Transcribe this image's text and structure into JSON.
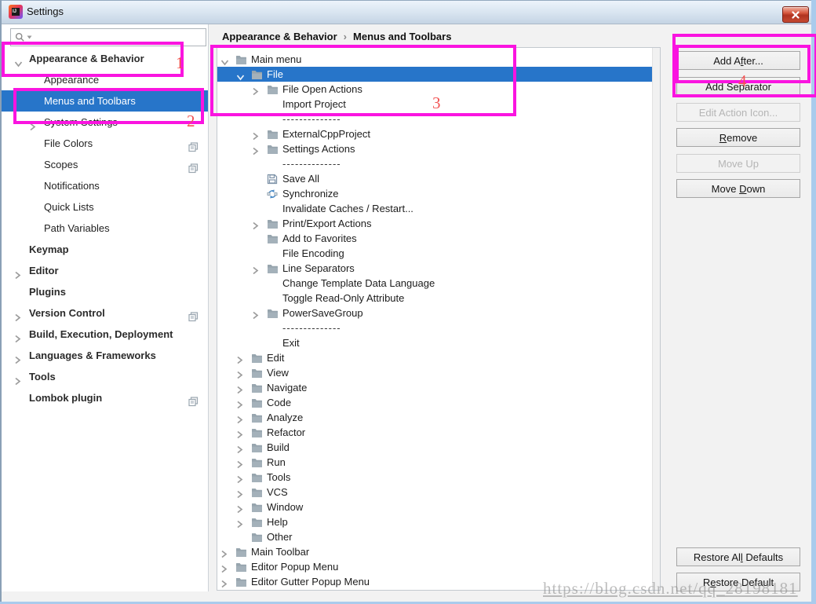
{
  "window": {
    "title": "Settings"
  },
  "search": {
    "value": "",
    "placeholder": ""
  },
  "breadcrumb": {
    "part1": "Appearance & Behavior",
    "separator": "›",
    "part2": "Menus and Toolbars"
  },
  "sidebar": {
    "items": [
      {
        "label": "Appearance & Behavior",
        "level": 0,
        "chevron": "down",
        "bold": true
      },
      {
        "label": "Appearance",
        "level": 1
      },
      {
        "label": "Menus and Toolbars",
        "level": 1,
        "selected": true
      },
      {
        "label": "System Settings",
        "level": 1,
        "chevron": "right"
      },
      {
        "label": "File Colors",
        "level": 1,
        "shared_icon": true
      },
      {
        "label": "Scopes",
        "level": 1,
        "shared_icon": true
      },
      {
        "label": "Notifications",
        "level": 1
      },
      {
        "label": "Quick Lists",
        "level": 1
      },
      {
        "label": "Path Variables",
        "level": 1
      },
      {
        "label": "Keymap",
        "level": 0,
        "bold": true
      },
      {
        "label": "Editor",
        "level": 0,
        "chevron": "right",
        "bold": true
      },
      {
        "label": "Plugins",
        "level": 0,
        "bold": true
      },
      {
        "label": "Version Control",
        "level": 0,
        "chevron": "right",
        "bold": true,
        "shared_icon": true
      },
      {
        "label": "Build, Execution, Deployment",
        "level": 0,
        "chevron": "right",
        "bold": true
      },
      {
        "label": "Languages & Frameworks",
        "level": 0,
        "chevron": "right",
        "bold": true
      },
      {
        "label": "Tools",
        "level": 0,
        "chevron": "right",
        "bold": true
      },
      {
        "label": "Lombok plugin",
        "level": 0,
        "bold": true,
        "shared_icon": true
      }
    ]
  },
  "tree": {
    "separator_label": "--------------",
    "rows": [
      {
        "label": "Main menu",
        "level": 0,
        "chevron": "down",
        "icon": "folder"
      },
      {
        "label": "File",
        "level": 1,
        "chevron": "down",
        "icon": "folder",
        "selected": true
      },
      {
        "label": "File Open Actions",
        "level": 2,
        "chevron": "right",
        "icon": "folder"
      },
      {
        "label": "Import Project",
        "level": 2
      },
      {
        "separator": true,
        "level": 2
      },
      {
        "label": "ExternalCppProject",
        "level": 2,
        "chevron": "right",
        "icon": "folder"
      },
      {
        "label": "Settings Actions",
        "level": 2,
        "chevron": "right",
        "icon": "folder"
      },
      {
        "separator": true,
        "level": 2
      },
      {
        "label": "Save All",
        "level": 2,
        "icon": "save"
      },
      {
        "label": "Synchronize",
        "level": 2,
        "icon": "sync"
      },
      {
        "label": "Invalidate Caches / Restart...",
        "level": 2
      },
      {
        "label": "Print/Export Actions",
        "level": 2,
        "chevron": "right",
        "icon": "folder"
      },
      {
        "label": "Add to Favorites",
        "level": 2,
        "icon": "folder"
      },
      {
        "label": "File Encoding",
        "level": 2
      },
      {
        "label": "Line Separators",
        "level": 2,
        "chevron": "right",
        "icon": "folder"
      },
      {
        "label": "Change Template Data Language",
        "level": 2
      },
      {
        "label": "Toggle Read-Only Attribute",
        "level": 2
      },
      {
        "label": "PowerSaveGroup",
        "level": 2,
        "chevron": "right",
        "icon": "folder"
      },
      {
        "separator": true,
        "level": 2
      },
      {
        "label": "Exit",
        "level": 2
      },
      {
        "label": "Edit",
        "level": 1,
        "chevron": "right",
        "icon": "folder"
      },
      {
        "label": "View",
        "level": 1,
        "chevron": "right",
        "icon": "folder"
      },
      {
        "label": "Navigate",
        "level": 1,
        "chevron": "right",
        "icon": "folder"
      },
      {
        "label": "Code",
        "level": 1,
        "chevron": "right",
        "icon": "folder"
      },
      {
        "label": "Analyze",
        "level": 1,
        "chevron": "right",
        "icon": "folder"
      },
      {
        "label": "Refactor",
        "level": 1,
        "chevron": "right",
        "icon": "folder"
      },
      {
        "label": "Build",
        "level": 1,
        "chevron": "right",
        "icon": "folder"
      },
      {
        "label": "Run",
        "level": 1,
        "chevron": "right",
        "icon": "folder"
      },
      {
        "label": "Tools",
        "level": 1,
        "chevron": "right",
        "icon": "folder"
      },
      {
        "label": "VCS",
        "level": 1,
        "chevron": "right",
        "icon": "folder"
      },
      {
        "label": "Window",
        "level": 1,
        "chevron": "right",
        "icon": "folder"
      },
      {
        "label": "Help",
        "level": 1,
        "chevron": "right",
        "icon": "folder"
      },
      {
        "label": "Other",
        "level": 1,
        "icon": "folder"
      },
      {
        "label": "Main Toolbar",
        "level": 0,
        "chevron": "right",
        "icon": "folder"
      },
      {
        "label": "Editor Popup Menu",
        "level": 0,
        "chevron": "right",
        "icon": "folder"
      },
      {
        "label": "Editor Gutter Popup Menu",
        "level": 0,
        "chevron": "right",
        "icon": "folder"
      }
    ]
  },
  "action_buttons": [
    {
      "id": "add-after",
      "pre": "Add A",
      "key": "f",
      "post": "ter...",
      "enabled": true
    },
    {
      "id": "add-separator",
      "pre": "Add Separator",
      "key": "",
      "post": "",
      "enabled": true
    },
    {
      "id": "edit-action-icon",
      "pre": "Edit Action Icon...",
      "key": "",
      "post": "",
      "enabled": false
    },
    {
      "id": "remove",
      "pre": "",
      "key": "R",
      "post": "emove",
      "enabled": true
    },
    {
      "id": "move-up",
      "pre": "Move Up",
      "key": "",
      "post": "",
      "enabled": false
    },
    {
      "id": "move-down",
      "pre": "Move ",
      "key": "D",
      "post": "own",
      "enabled": true
    }
  ],
  "restore_buttons": [
    {
      "id": "restore-all-defaults",
      "pre": "Restore Al",
      "key": "l",
      "post": " Defaults",
      "enabled": true
    },
    {
      "id": "restore-default",
      "pre": "R",
      "key": "e",
      "post": "store Default",
      "enabled": true
    }
  ],
  "annotations": {
    "box_color": "#FA14E0",
    "label_color": "#F25353",
    "labels": [
      {
        "text": "1"
      },
      {
        "text": "2"
      },
      {
        "text": "3"
      },
      {
        "text": "4"
      }
    ]
  },
  "watermark": {
    "text": "https://blog.csdn.net/qq_28198181"
  },
  "colors": {
    "selection": "#2775C9",
    "folder": "#97A5AE",
    "sync_arrow": "#4889C6",
    "title_bg": "#d8e4f0"
  }
}
